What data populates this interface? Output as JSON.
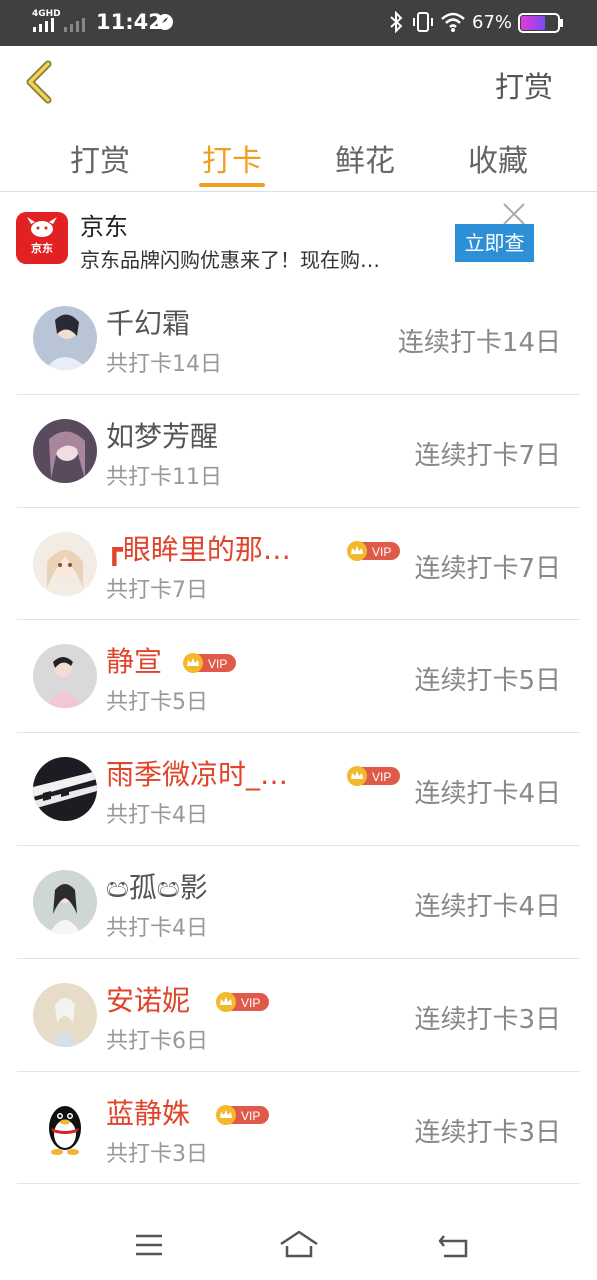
{
  "status_bar": {
    "network": "4GHD",
    "time": "11:42",
    "battery_pct": "67%",
    "battery_level": 0.67
  },
  "header": {
    "action_label": "打赏"
  },
  "tabs": [
    {
      "label": "打赏",
      "active": false
    },
    {
      "label": "打卡",
      "active": true
    },
    {
      "label": "鲜花",
      "active": false
    },
    {
      "label": "收藏",
      "active": false
    }
  ],
  "ad": {
    "logo_text": "京东",
    "title": "京东",
    "description": "京东品牌闪购优惠来了！现在购…",
    "cta": "立即查"
  },
  "vip_label": "VIP",
  "list": [
    {
      "name": "千幻霜",
      "total": "共打卡14日",
      "streak": "连续打卡14日",
      "vip": false
    },
    {
      "name": "如梦芳醒",
      "total": "共打卡11日",
      "streak": "连续打卡7日",
      "vip": false
    },
    {
      "name": "┏眼眸里的那…",
      "total": "共打卡7日",
      "streak": "连续打卡7日",
      "vip": true
    },
    {
      "name": "静宣",
      "total": "共打卡5日",
      "streak": "连续打卡5日",
      "vip": true
    },
    {
      "name": "雨季微凉时_…",
      "total": "共打卡4日",
      "streak": "连续打卡4日",
      "vip": true
    },
    {
      "name": "ඏ孤ඏ影",
      "total": "共打卡4日",
      "streak": "连续打卡4日",
      "vip": false
    },
    {
      "name": "安诺妮",
      "total": "共打卡6日",
      "streak": "连续打卡3日",
      "vip": true
    },
    {
      "name": "蓝静姝",
      "total": "共打卡3日",
      "streak": "连续打卡3日",
      "vip": true
    }
  ],
  "colors": {
    "accent": "#f0a020",
    "vip_name": "#e0452c",
    "ad_cta": "#2d8fd5",
    "status_bar": "#404040"
  }
}
